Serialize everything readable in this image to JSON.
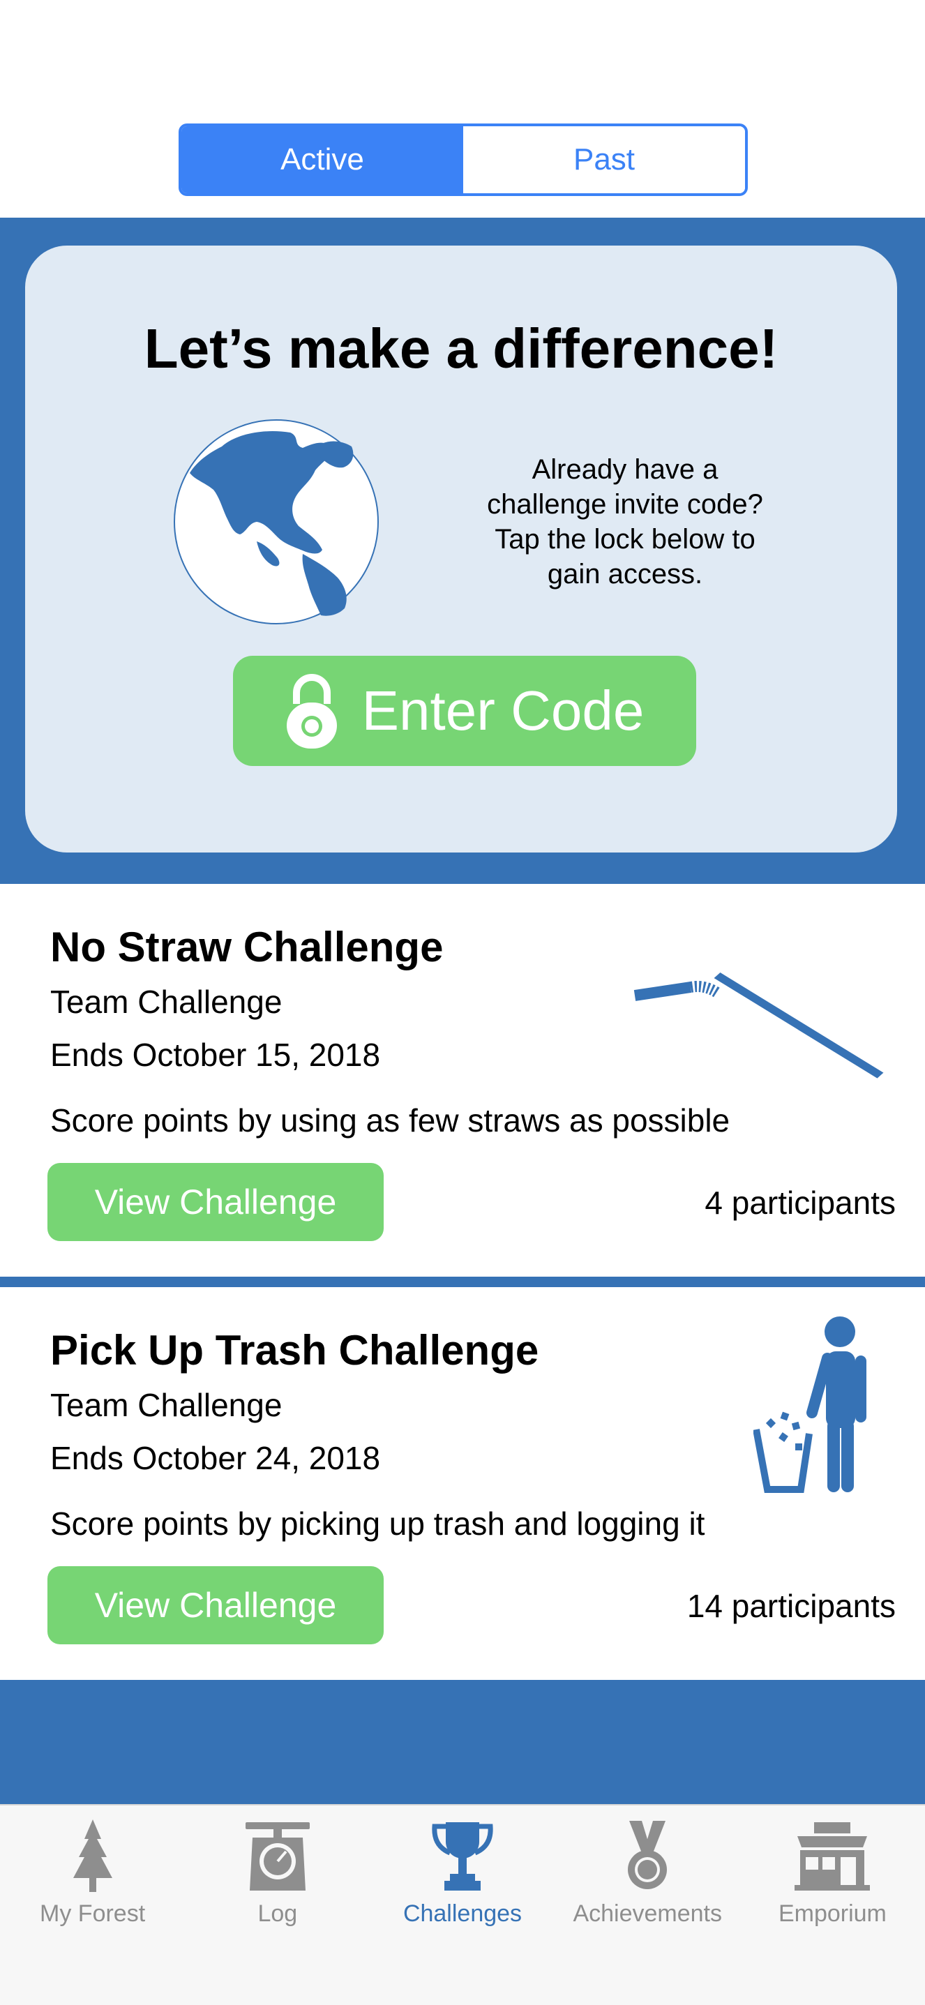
{
  "segmented": {
    "active_label": "Active",
    "past_label": "Past"
  },
  "hero": {
    "title": "Let’s make a difference!",
    "text_lines": [
      "Already have a",
      "challenge invite code?",
      "Tap the lock below to",
      "gain access."
    ],
    "button_label": "Enter Code"
  },
  "challenges": [
    {
      "title": "No Straw Challenge",
      "type": "Team Challenge",
      "ends": "Ends October 15, 2018",
      "description": "Score points by using as few straws as possible",
      "button_label": "View Challenge",
      "participants": "4 participants",
      "icon": "straw-icon"
    },
    {
      "title": "Pick Up Trash Challenge",
      "type": "Team Challenge",
      "ends": "Ends October 24, 2018",
      "description": "Score points by picking up trash and logging it",
      "button_label": "View Challenge",
      "participants": "14 participants",
      "icon": "trash-person-icon"
    }
  ],
  "tabbar": {
    "items": [
      {
        "label": "My Forest",
        "icon": "tree-icon",
        "active": false
      },
      {
        "label": "Log",
        "icon": "scale-icon",
        "active": false
      },
      {
        "label": "Challenges",
        "icon": "trophy-icon",
        "active": true
      },
      {
        "label": "Achievements",
        "icon": "medal-icon",
        "active": false
      },
      {
        "label": "Emporium",
        "icon": "store-icon",
        "active": false
      }
    ]
  },
  "colors": {
    "accent_blue": "#3b82f6",
    "band_blue": "#3672b5",
    "card_bg": "#e0eaf4",
    "button_green": "#77d574",
    "tab_inactive": "#8e8e8e"
  }
}
